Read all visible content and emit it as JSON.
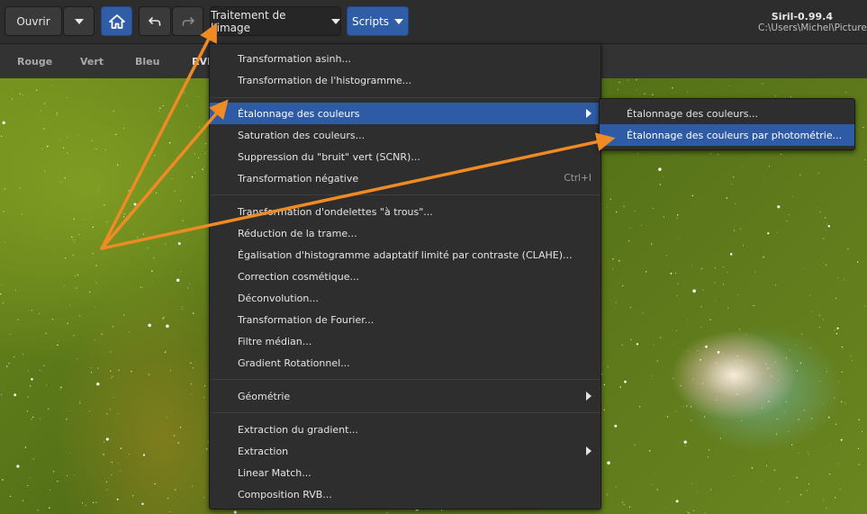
{
  "toolbar": {
    "open_label": "Ouvrir",
    "image_processing_label": "Traitement de l'image",
    "scripts_label": "Scripts"
  },
  "app": {
    "title": "Siril-0.99.4",
    "path": "C:\\Users\\Michel\\Pictures"
  },
  "tabs": [
    {
      "label": "Rouge"
    },
    {
      "label": "Vert"
    },
    {
      "label": "Bleu"
    },
    {
      "label": "RVB"
    }
  ],
  "menu": {
    "items": [
      {
        "label": "Transformation asinh..."
      },
      {
        "label": "Transformation de l'histogramme..."
      },
      {
        "label": "Étalonnage des couleurs",
        "submenu": true,
        "highlighted": true
      },
      {
        "label": "Saturation des couleurs..."
      },
      {
        "label": "Suppression du \"bruit\" vert (SCNR)..."
      },
      {
        "label": "Transformation négative",
        "accel": "Ctrl+I"
      },
      {
        "label": "Transformation d'ondelettes \"à trous\"..."
      },
      {
        "label": "Réduction de la trame..."
      },
      {
        "label": "Égalisation d'histogramme adaptatif limité par contraste (CLAHE)..."
      },
      {
        "label": "Correction cosmétique..."
      },
      {
        "label": "Déconvolution..."
      },
      {
        "label": "Transformation de Fourier..."
      },
      {
        "label": "Filtre médian..."
      },
      {
        "label": "Gradient Rotationnel..."
      },
      {
        "label": "Géométrie",
        "submenu": true
      },
      {
        "label": "Extraction du gradient..."
      },
      {
        "label": "Extraction",
        "submenu": true
      },
      {
        "label": "Linear Match..."
      },
      {
        "label": "Composition RVB..."
      }
    ]
  },
  "submenu": {
    "items": [
      {
        "label": "Étalonnage des couleurs..."
      },
      {
        "label": "Étalonnage des couleurs par photométrie...",
        "highlighted": true
      }
    ]
  },
  "icons": {
    "menu_dropdown": "chevron-down-icon",
    "home": "home-icon",
    "undo": "undo-icon",
    "redo": "redo-icon",
    "submenu_arrow": "chevron-right-icon"
  },
  "colors": {
    "accent": "#2f5ba6",
    "annotation_arrow": "#f08a24"
  }
}
